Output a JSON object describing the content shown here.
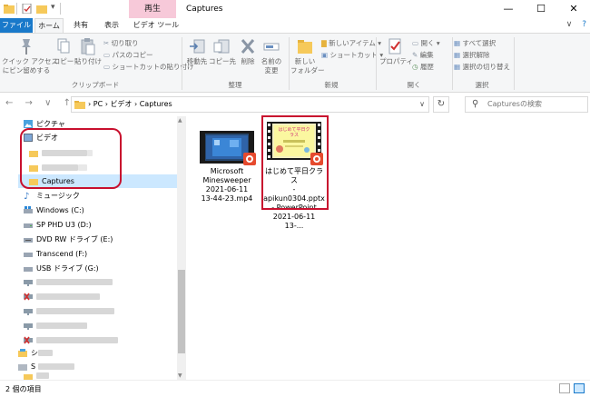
{
  "window": {
    "title": "Captures",
    "context_tab": "再生",
    "controls": {
      "minimize": "—",
      "maximize": "☐",
      "close": "✕"
    }
  },
  "tabs": {
    "file": "ファイル",
    "home": "ホーム",
    "share": "共有",
    "view": "表示",
    "video_tools": "ビデオ ツール",
    "expand": "∨",
    "help": "?"
  },
  "ribbon": {
    "clipboard": {
      "label": "クリップボード",
      "pin": [
        "クイック アクセス",
        "にピン留めする"
      ],
      "copy": "コピー",
      "paste": "貼り付け",
      "cut": "切り取り",
      "copy_path": "パスのコピー",
      "paste_shortcut": "ショートカットの貼り付け"
    },
    "organize": {
      "label": "整理",
      "move_to": "移動先",
      "copy_to": "コピー先",
      "delete": "削除",
      "rename": [
        "名前の",
        "変更"
      ]
    },
    "new": {
      "label": "新規",
      "new_folder": [
        "新しい",
        "フォルダー"
      ],
      "new_item": "新しいアイテム",
      "shortcut": "ショートカット"
    },
    "open": {
      "label": "開く",
      "properties": "プロパティ",
      "open": "開く",
      "edit": "編集",
      "history": "履歴"
    },
    "select": {
      "label": "選択",
      "select_all": "すべて選択",
      "select_none": "選択解除",
      "invert": "選択の切り替え"
    }
  },
  "address": {
    "nav": "← → ∨ ↑",
    "path": "›   PC  ›  ビデオ  ›  Captures",
    "search_placeholder": "Capturesの検索"
  },
  "nav": {
    "items": [
      {
        "label": "ピクチャ"
      },
      {
        "label": "ビデオ"
      },
      {
        "label": ""
      },
      {
        "label": ""
      },
      {
        "label": "Captures"
      },
      {
        "label": "ミュージック"
      },
      {
        "label": "Windows (C:)"
      },
      {
        "label": "SP PHD U3 (D:)"
      },
      {
        "label": "DVD RW ドライブ (E:)"
      },
      {
        "label": "Transcend (F:)"
      },
      {
        "label": "USB ドライブ (G:)"
      },
      {
        "label": ""
      },
      {
        "label": ""
      },
      {
        "label": ""
      },
      {
        "label": ""
      },
      {
        "label": ""
      },
      {
        "label": "シ"
      },
      {
        "label": "S"
      },
      {
        "label": ""
      }
    ]
  },
  "files": [
    {
      "name": [
        "Microsoft",
        "Minesweeper",
        "2021-06-11",
        "13-44-23.mp4"
      ]
    },
    {
      "name": [
        "はじめて平日クラス",
        "-apikun0304.pptx",
        "- PowerPoint",
        "2021-06-11 13-..."
      ],
      "thumb_text": "はじめて平日クラス"
    }
  ],
  "status": {
    "count": "2 個の項目"
  },
  "colors": {
    "accent": "#1979ca",
    "context": "#f7c9d9",
    "highlight": "#c8102e",
    "selected": "#cce8ff",
    "folder": "#f6c95a"
  }
}
